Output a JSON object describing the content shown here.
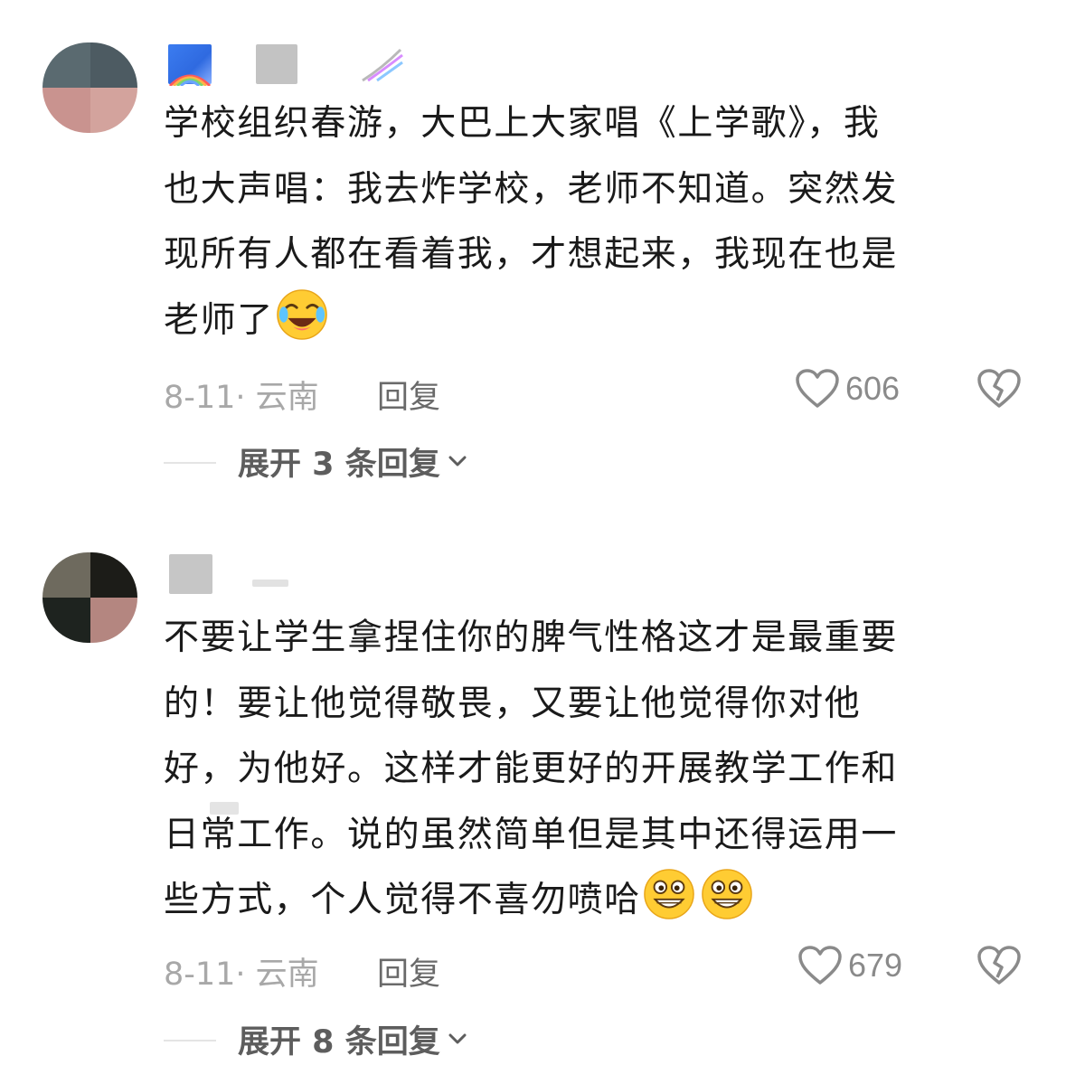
{
  "comments": [
    {
      "text_lines": [
        "学校组织春游，大巴上大家唱《上学歌》，我",
        "也大声唱：我去炸学校，老师不知道。突然发",
        "现所有人都在看着我，才想起来，我现在也是",
        "老师了"
      ],
      "emojis": [
        "crying-laughing-emoji"
      ],
      "date_location": "8-11· 云南",
      "reply_label": "回复",
      "like_count": "606",
      "expand_label": "展开 3 条回复",
      "avatar_colors": [
        "#5a6a70",
        "#4d5b62",
        "#c9938f",
        "#d3a39d"
      ]
    },
    {
      "text_lines": [
        "不要让学生拿捏住你的脾气性格这才是最重要",
        "的！要让他觉得敬畏，又要让他觉得你对他",
        "好，为他好。这样才能更好的开展教学工作和",
        "日常工作。说的虽然简单但是其中还得运用一",
        "些方式，个人觉得不喜勿喷哈"
      ],
      "emojis": [
        "grinning-emoji",
        "grinning-emoji"
      ],
      "date_location": "8-11· 云南",
      "reply_label": "回复",
      "like_count": "679",
      "expand_label": "展开 8 条回复",
      "avatar_colors": [
        "#6e6a5e",
        "#1c1c18",
        "#1e231f",
        "#b48680"
      ]
    }
  ],
  "colors": {
    "text": "#1a1a1a",
    "meta": "#a8a8a8",
    "reply": "#6a6a6a",
    "emoji_yellow": "#ffcc33"
  }
}
